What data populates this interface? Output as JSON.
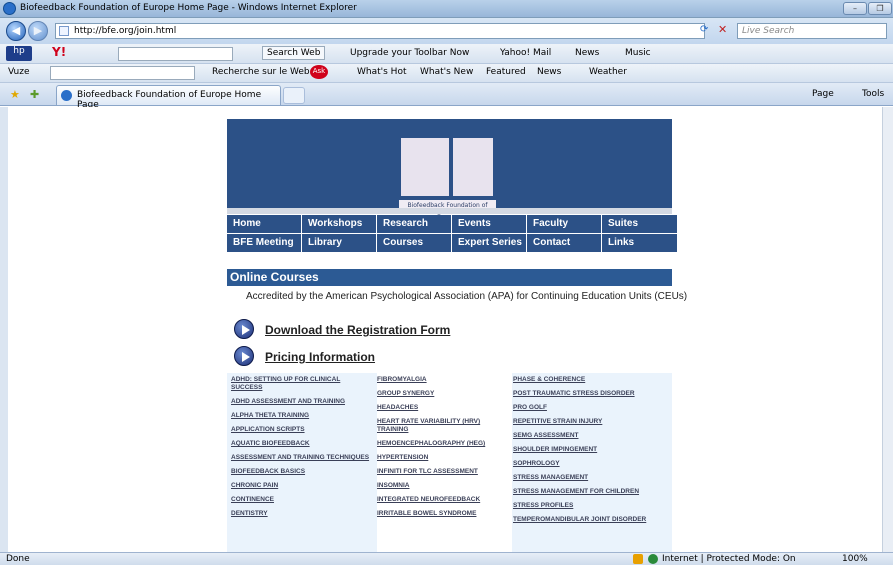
{
  "window": {
    "title": "Biofeedback Foundation of Europe Home Page - Windows Internet Explorer"
  },
  "address": {
    "url": "http://bfe.org/join.html",
    "search_placeholder": "Live Search"
  },
  "toolbar1": {
    "search_web": "Search Web",
    "upgrade": "Upgrade your Toolbar Now",
    "yahoo_mail": "Yahoo! Mail",
    "news": "News",
    "music": "Music"
  },
  "toolbar2": {
    "vuze": "Vuze",
    "recherche": "Recherche sur le Web",
    "whats_hot": "What's Hot",
    "whats_new": "What's New",
    "featured": "Featured",
    "news": "News",
    "weather": "Weather"
  },
  "tabs": {
    "active": "Biofeedback Foundation of Europe Home Page",
    "page_menu": "Page",
    "tools_menu": "Tools"
  },
  "banner": {
    "logo_caption": "Biofeedback Foundation of Europe"
  },
  "nav": [
    [
      "Home",
      "Workshops",
      "Research",
      "Events",
      "Faculty",
      "Suites"
    ],
    [
      "BFE Meeting",
      "Library",
      "Courses",
      "Expert Series",
      "Contact",
      "Links"
    ]
  ],
  "section": {
    "title": "Online Courses",
    "accreditation": "Accredited by the American Psychological Association (APA) for Continuing Education Units (CEUs)",
    "download": "Download the Registration Form",
    "pricing": "Pricing Information"
  },
  "courses": {
    "col1": [
      "ADHD: SETTING UP FOR CLINICAL SUCCESS",
      "ADHD ASSESSMENT AND TRAINING",
      "ALPHA THETA TRAINING",
      "APPLICATION SCRIPTS",
      "AQUATIC BIOFEEDBACK",
      "ASSESSMENT AND TRAINING TECHNIQUES",
      "BIOFEEDBACK BASICS",
      "CHRONIC PAIN",
      "CONTINENCE",
      "DENTISTRY"
    ],
    "col2": [
      "FIBROMYALGIA",
      "GROUP SYNERGY",
      "HEADACHES",
      "HEART RATE VARIABILITY (HRV) TRAINING",
      "HEMOENCEPHALOGRAPHY (HEG)",
      "HYPERTENSION",
      "INFINITI FOR TLC ASSESSMENT",
      "INSOMNIA",
      "INTEGRATED NEUROFEEDBACK",
      "IRRITABLE BOWEL SYNDROME"
    ],
    "col3": [
      "PHASE & COHERENCE",
      "POST TRAUMATIC STRESS DISORDER",
      "PRO GOLF",
      "REPETITIVE STRAIN INJURY",
      "SEMG ASSESSMENT",
      "SHOULDER IMPINGEMENT",
      "SOPHROLOGY",
      "STRESS MANAGEMENT",
      "STRESS MANAGEMENT FOR CHILDREN",
      "STRESS PROFILES",
      "TEMPEROMANDIBULAR JOINT DISORDER"
    ]
  },
  "status": {
    "left": "Done",
    "zone": "Internet | Protected Mode: On",
    "zoom": "100%"
  },
  "colors": {
    "banner": "#2c5187",
    "section": "#2c5a94",
    "course_bg": "#eaf3fc"
  }
}
